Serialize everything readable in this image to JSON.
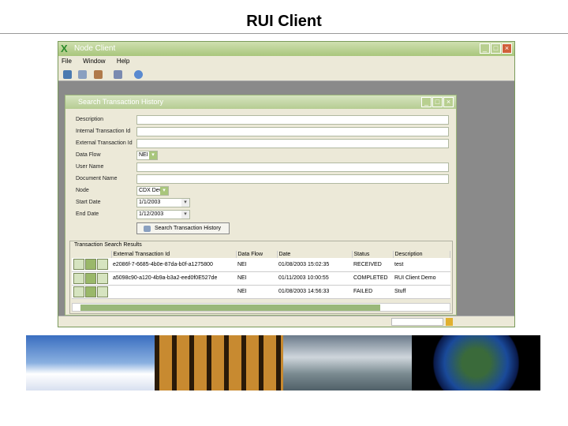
{
  "slide_title": "RUI Client",
  "window": {
    "title": "Node Client",
    "menu": [
      "File",
      "Window",
      "Help"
    ]
  },
  "dialog": {
    "title": "Search Transaction History",
    "fields": [
      {
        "label": "Description",
        "value": ""
      },
      {
        "label": "Internal Transaction Id",
        "value": ""
      },
      {
        "label": "External Transaction Id",
        "value": ""
      },
      {
        "label": "Data Flow",
        "value": "NEI"
      },
      {
        "label": "User Name",
        "value": ""
      },
      {
        "label": "Document Name",
        "value": ""
      },
      {
        "label": "Node",
        "value": "CDX Dev"
      },
      {
        "label": "Start Date",
        "value": "1/1/2003"
      },
      {
        "label": "End Date",
        "value": "1/12/2003"
      }
    ],
    "search_button": "Search Transaction History"
  },
  "results": {
    "title": "Transaction Search Results",
    "columns": [
      "External Transaction Id",
      "Data Flow",
      "Date",
      "Status",
      "Description"
    ],
    "rows": [
      [
        "e2086f-7-6685-4b0e-87da-b0f-a1275800",
        "NEI",
        "01/08/2003 15:02:35",
        "RECEIVED",
        "test"
      ],
      [
        "a5098c90-a120-4b9a-b3a2-eed0f0E527de",
        "NEI",
        "01/11/2003 10:00:55",
        "COMPLETED",
        "RUI Client Demo"
      ],
      [
        "",
        "NEI",
        "01/08/2003 14:56:33",
        "FAILED",
        "Stuff"
      ]
    ]
  }
}
